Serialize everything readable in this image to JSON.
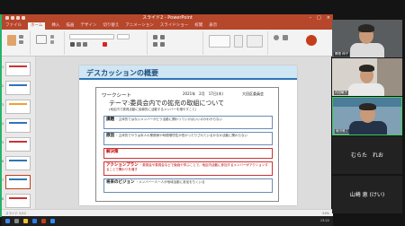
{
  "powerpoint": {
    "title": "スライド2 - PowerPoint",
    "menu_tabs": [
      "ファイル",
      "ホーム",
      "挿入",
      "描画",
      "デザイン",
      "切り替え",
      "アニメーション",
      "スライドショー",
      "校閲",
      "表示"
    ],
    "slide": {
      "header": "デスカッションの概要",
      "worksheet": {
        "label": "ワークシート",
        "date": "2021年　2月　17日(木)",
        "org": "大田区委員会",
        "theme": "テーマ:委員会内での拡充の取組について",
        "subnote": "(地区内で委員活動に協働的に活動するメンバーを増やすこと)",
        "boxes": [
          {
            "title": "課題",
            "text": "・主体的ではないメンバーがどう活動に関わっていけばいいのかわからない"
          },
          {
            "title": "原因",
            "text": "・主体的でやりは本人の業務側や時間環境性が低かったりされているかなか活動に関わらない"
          },
          {
            "title": "解決策",
            "text": ""
          },
          {
            "title": "アクションプラン",
            "text": "・委員会や委員会などで勉強や学ぶことで、地区内活動に参加するメンバーがアクションすることで関わりを増す"
          },
          {
            "title": "将来のビジョン",
            "text": "・メンバー一人一人が地域活動に参加をちくいる"
          }
        ]
      }
    },
    "status": "スライド 2/12",
    "zoom": "54%",
    "clock": "13:22"
  },
  "participants": [
    {
      "name": "関根 伸子",
      "type": "video",
      "active": false,
      "bg": "#5a5d5f",
      "shirt": "#dcdcdc"
    },
    {
      "name": "内田敏子",
      "type": "video",
      "active": false,
      "bg": "#d7d3cc",
      "shirt": "#e9e9e9"
    },
    {
      "name": "植田雅之",
      "type": "video",
      "active": true,
      "bg": "#7fa0b5",
      "shirt": "#243348"
    },
    {
      "name": "むらた　れお",
      "type": "name",
      "active": false
    },
    {
      "name": "山崎 恵 (けい)",
      "type": "name",
      "active": false
    }
  ],
  "colors": {
    "accent": "#b7472a",
    "share_border": "#26b36a",
    "speaker_border": "#3ccf5a"
  }
}
